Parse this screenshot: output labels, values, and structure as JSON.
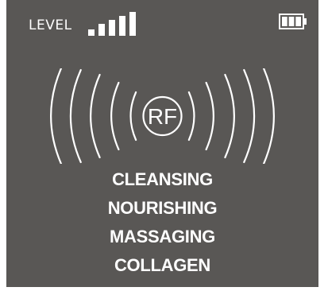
{
  "header": {
    "level_label": "LEVEL",
    "level_icon": "signal-bars-icon",
    "battery_icon": "battery-icon"
  },
  "level": {
    "value": 4,
    "max": 5
  },
  "battery": {
    "charge_segments": 3,
    "total_segments": 3
  },
  "center": {
    "badge_label": "RF",
    "wave_icon": "rf-waves-icon"
  },
  "modes": [
    {
      "label": "CLEANSING"
    },
    {
      "label": "NOURISHING"
    },
    {
      "label": "MASSAGING"
    },
    {
      "label": "COLLAGEN"
    }
  ],
  "colors": {
    "screen_background": "#595755",
    "foreground": "#ffffff"
  }
}
